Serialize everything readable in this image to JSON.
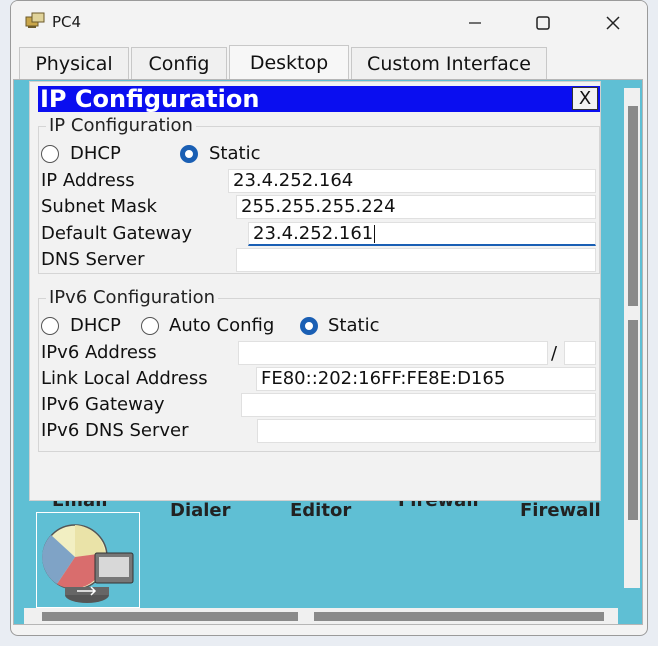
{
  "window": {
    "title": "PC4"
  },
  "tabs": [
    {
      "label": "Physical",
      "active": false
    },
    {
      "label": "Config",
      "active": false
    },
    {
      "label": "Desktop",
      "active": true
    },
    {
      "label": "Custom Interface",
      "active": false
    }
  ],
  "desktop": {
    "labels": [
      "Email",
      "Dialer",
      "Editor",
      "Firewall",
      "Firewall"
    ]
  },
  "dialog": {
    "title": "IP Configuration",
    "close_label": "X",
    "ipv4": {
      "legend": "IP Configuration",
      "mode_options": [
        "DHCP",
        "Static"
      ],
      "mode_selected": "Static",
      "ip_address_label": "IP Address",
      "ip_address": "23.4.252.164",
      "subnet_label": "Subnet Mask",
      "subnet": "255.255.255.224",
      "gateway_label": "Default Gateway",
      "gateway": "23.4.252.161",
      "dns_label": "DNS Server",
      "dns": ""
    },
    "ipv6": {
      "legend": "IPv6 Configuration",
      "mode_options": [
        "DHCP",
        "Auto Config",
        "Static"
      ],
      "mode_selected": "Static",
      "address_label": "IPv6 Address",
      "address": "",
      "prefix_separator": "/",
      "prefix": "",
      "link_local_label": "Link Local Address",
      "link_local": "FE80::202:16FF:FE8E:D165",
      "gateway_label": "IPv6 Gateway",
      "gateway": "",
      "dns_label": "IPv6 DNS Server",
      "dns": ""
    }
  },
  "colors": {
    "dialog_header": "#0a0ef0",
    "desktop_bg": "#5fbfd4",
    "radio_selected": "#1a5fb4"
  }
}
